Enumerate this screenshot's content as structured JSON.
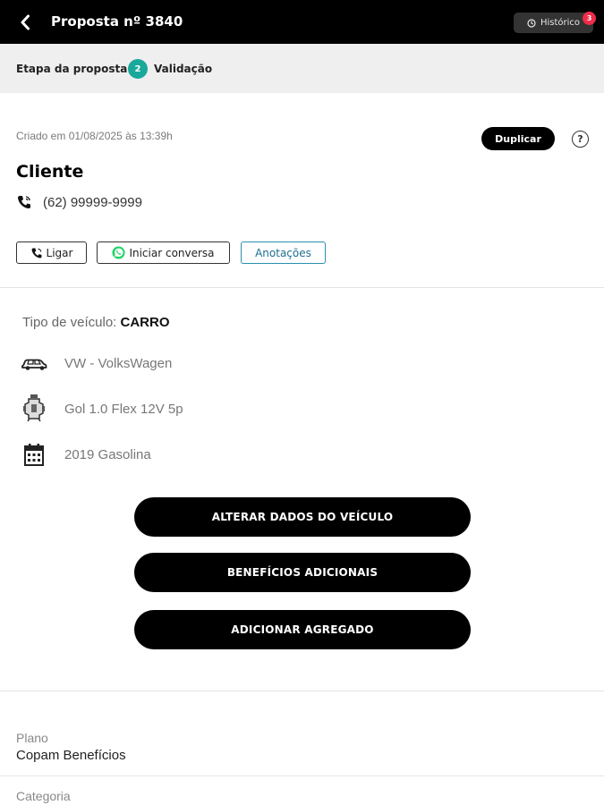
{
  "header": {
    "title": "Proposta nº 3840",
    "history_label": "Histórico",
    "history_badge": "3"
  },
  "stage": {
    "label": "Etapa da proposta:",
    "number": "2",
    "name": "Validação"
  },
  "client": {
    "created": "Criado em 01/08/2025 às 13:39h",
    "duplicate_label": "Duplicar",
    "help_label": "?",
    "name": "Cliente",
    "phone": "(62) 99999-9999",
    "actions": {
      "call": "Ligar",
      "chat": "Iniciar conversa",
      "notes": "Anotações"
    }
  },
  "vehicle": {
    "type_label": "Tipo de veículo:",
    "type_value": "CARRO",
    "brand": "VW - VolksWagen",
    "model": "Gol 1.0 Flex 12V 5p",
    "year": "2019 Gasolina"
  },
  "buttons": {
    "edit_vehicle": "ALTERAR DADOS DO VEÍCULO",
    "benefits": "BENEFÍCIOS ADICIONAIS",
    "add_aggregate": "ADICIONAR AGREGADO"
  },
  "plan": {
    "label": "Plano",
    "value": "Copam Benefícios"
  },
  "category": {
    "label": "Categoria"
  },
  "colors": {
    "accent": "#1aa89b",
    "badge": "#ef2b4a",
    "notes_border": "#2a8fb0"
  }
}
